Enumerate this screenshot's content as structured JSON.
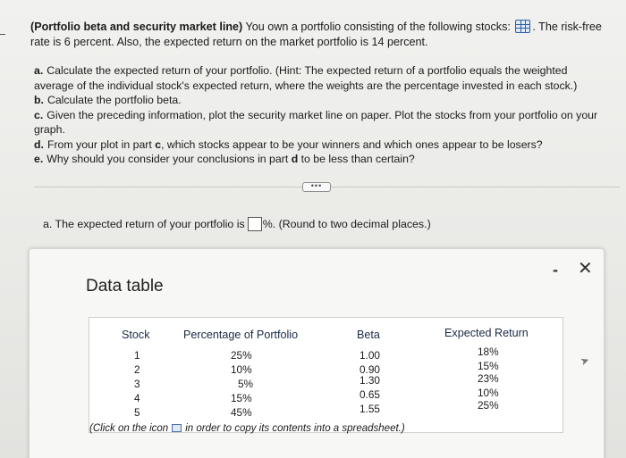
{
  "problem": {
    "title": "(Portfolio beta and security market line)",
    "text1": "You own a portfolio consisting of the following stocks:",
    "text2": ". The risk-free",
    "text3": "rate is 6 percent. Also, the expected return on the market portfolio is 14 percent."
  },
  "parts": {
    "a_letter": "a.",
    "a_line1": "Calculate the expected return of your portfolio. (Hint: The expected return of a portfolio equals the weighted",
    "a_line2": "average of the individual stock's expected return, where the weights are the percentage invested in each stock.)",
    "b_letter": "b.",
    "b_text": "Calculate the portfolio beta.",
    "c_letter": "c.",
    "c_line1": "Given the preceding information, plot the security market line on paper. Plot the stocks from your portfolio on your",
    "c_line2": "graph.",
    "d_letter": "d.",
    "d_text_pre": "From your plot in part",
    "d_bold": "c",
    "d_text_post": ", which stocks appear to be your winners and which ones appear to be losers?",
    "e_letter": "e.",
    "e_text_pre": "Why should you consider your conclusions in part",
    "e_bold": "d",
    "e_text_post": "to be less than certain?"
  },
  "expand_button": "•••",
  "answer": {
    "prefix": "a. The expected return of your portfolio is",
    "suffix": "%. (Round to two decimal places.)",
    "value": ""
  },
  "popup": {
    "title": "Data table",
    "minimize": "-",
    "close": "✕",
    "headers": {
      "stock": "Stock",
      "pct": "Percentage of Portfolio",
      "beta": "Beta",
      "ret": "Expected Return"
    },
    "rows": [
      {
        "stock": "1",
        "pct": "25%",
        "beta": "1.00",
        "ret": "18%"
      },
      {
        "stock": "2",
        "pct": "10%",
        "beta": "0.90",
        "ret": "15%"
      },
      {
        "stock": "3",
        "pct": "5%",
        "beta": "1.30",
        "ret": "23%"
      },
      {
        "stock": "4",
        "pct": "15%",
        "beta": "0.65",
        "ret": "10%"
      },
      {
        "stock": "5",
        "pct": "45%",
        "beta": "1.55",
        "ret": "25%"
      }
    ],
    "copy_note_pre": "(Click on the icon",
    "copy_note_post": "in order to copy its contents into a spreadsheet.)"
  }
}
